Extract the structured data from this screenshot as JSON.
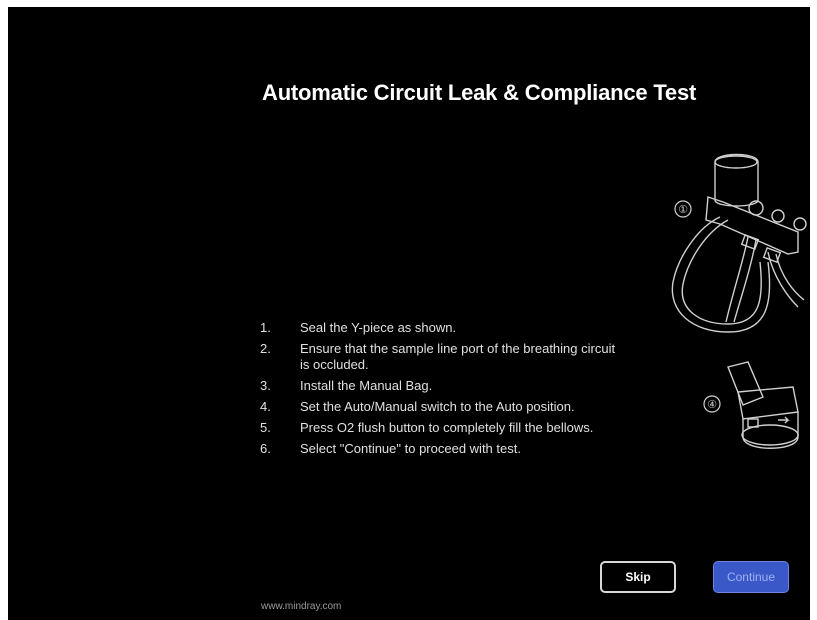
{
  "title": "Automatic Circuit Leak & Compliance Test",
  "steps": [
    {
      "num": "1.",
      "text": "Seal the Y-piece as shown."
    },
    {
      "num": "2.",
      "text": "Ensure that the sample line port of the breathing circuit is occluded."
    },
    {
      "num": "3.",
      "text": "Install the Manual Bag."
    },
    {
      "num": "4.",
      "text": "Set the Auto/Manual switch to the Auto position."
    },
    {
      "num": "5.",
      "text": "Press O2 flush button to completely fill the bellows."
    },
    {
      "num": "6.",
      "text": "Select \"Continue\" to proceed with test."
    }
  ],
  "illustrations": {
    "circuit_label": "①",
    "switch_label": "④"
  },
  "buttons": {
    "skip": "Skip",
    "continue": "Continue"
  },
  "footer": {
    "url": "www.mindray.com"
  },
  "colors": {
    "background": "#000000",
    "continue_button": "#3b58c8",
    "skip_border": "#d8d8d8"
  }
}
